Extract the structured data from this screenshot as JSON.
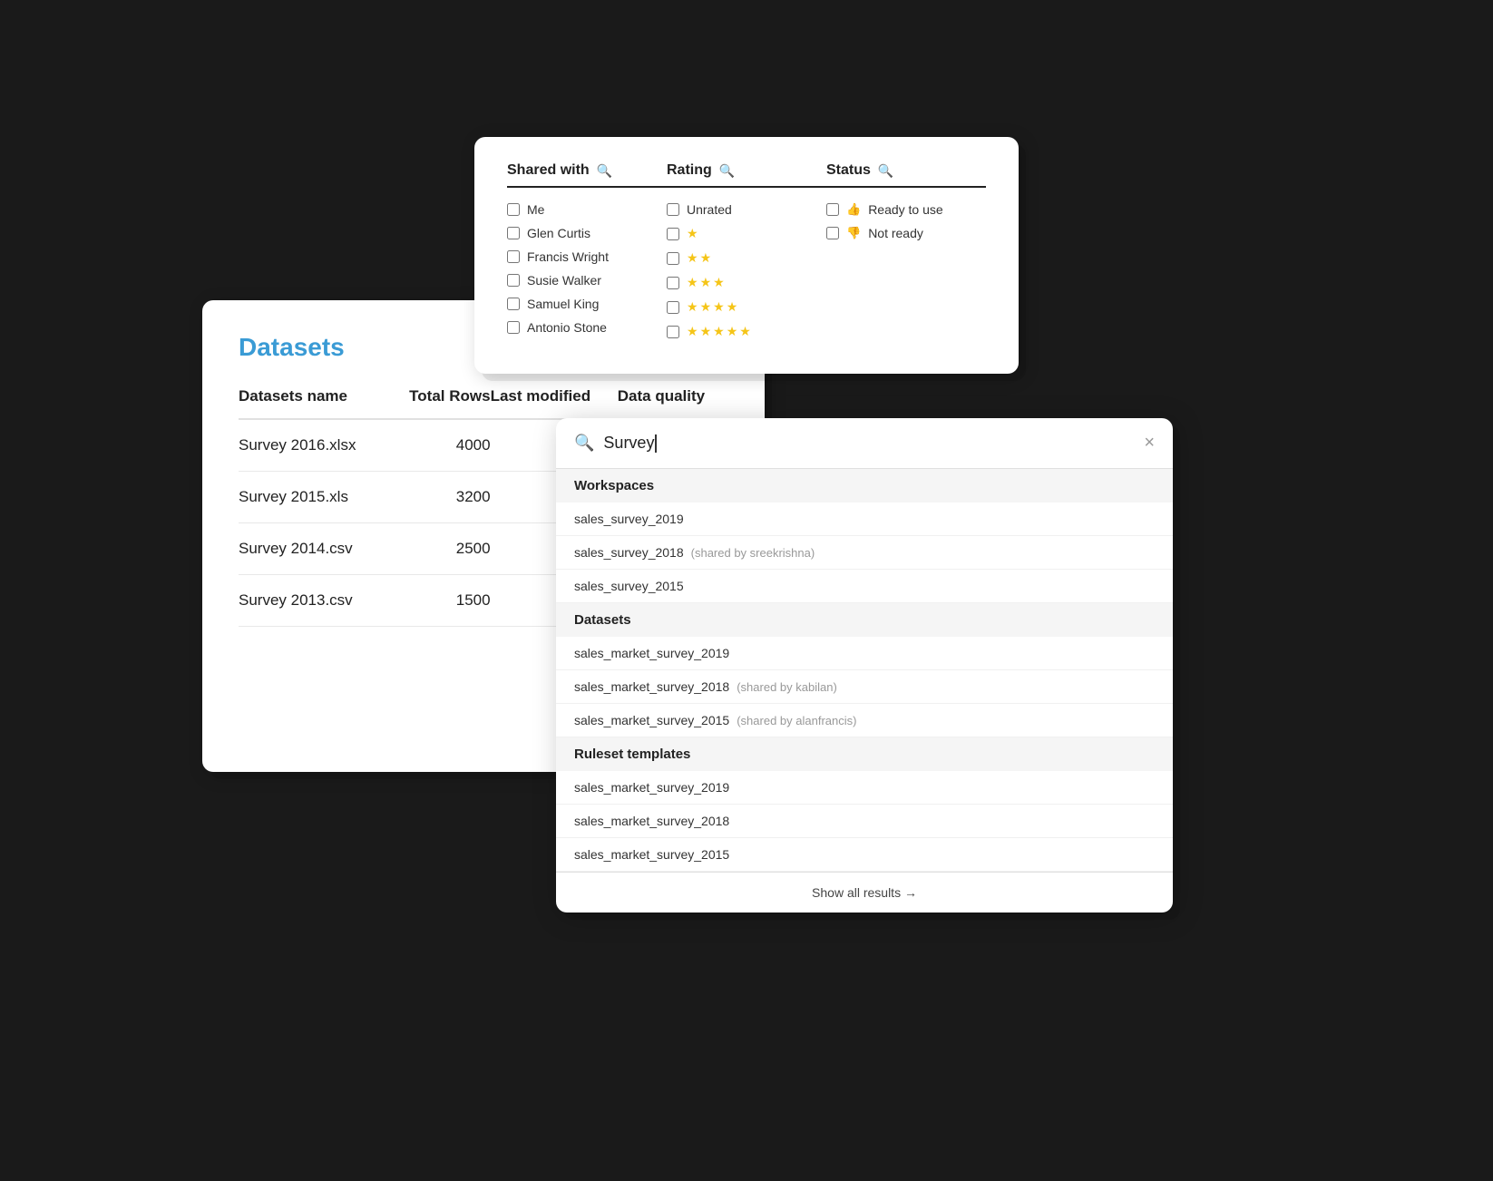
{
  "datasets_card": {
    "title": "Datasets",
    "table": {
      "headers": [
        "Datasets name",
        "Total Rows",
        "Last modified",
        "Data quality"
      ],
      "rows": [
        {
          "name": "Survey 2016.xlsx",
          "rows": "4000",
          "modified": "",
          "quality": ""
        },
        {
          "name": "Survey 2015.xls",
          "rows": "3200",
          "modified": "",
          "quality": ""
        },
        {
          "name": "Survey 2014.csv",
          "rows": "2500",
          "modified": "",
          "quality": ""
        },
        {
          "name": "Survey 2013.csv",
          "rows": "1500",
          "modified": "",
          "quality": ""
        }
      ]
    }
  },
  "filter_card": {
    "shared_with": {
      "label": "Shared with",
      "items": [
        "Me",
        "Glen Curtis",
        "Francis Wright",
        "Susie Walker",
        "Samuel King",
        "Antonio Stone"
      ]
    },
    "rating": {
      "label": "Rating",
      "items": [
        {
          "label": "Unrated",
          "stars": 0
        },
        {
          "label": "",
          "stars": 1
        },
        {
          "label": "",
          "stars": 2
        },
        {
          "label": "",
          "stars": 3
        },
        {
          "label": "",
          "stars": 4
        },
        {
          "label": "",
          "stars": 5
        }
      ]
    },
    "status": {
      "label": "Status",
      "items": [
        {
          "label": "Ready to use",
          "icon": "thumbs-up"
        },
        {
          "label": "Not ready",
          "icon": "thumbs-down"
        }
      ]
    }
  },
  "search_card": {
    "query": "Survey",
    "close_label": "×",
    "sections": [
      {
        "label": "Workspaces",
        "items": [
          {
            "name": "sales_survey_2019",
            "shared": ""
          },
          {
            "name": "sales_survey_2018",
            "shared": "(shared by sreekrishna)"
          },
          {
            "name": "sales_survey_2015",
            "shared": ""
          }
        ]
      },
      {
        "label": "Datasets",
        "items": [
          {
            "name": "sales_market_survey_2019",
            "shared": ""
          },
          {
            "name": "sales_market_survey_2018",
            "shared": "(shared by kabilan)"
          },
          {
            "name": "sales_market_survey_2015",
            "shared": "(shared by alanfrancis)"
          }
        ]
      },
      {
        "label": "Ruleset templates",
        "items": [
          {
            "name": "sales_market_survey_2019",
            "shared": ""
          },
          {
            "name": "sales_market_survey_2018",
            "shared": ""
          },
          {
            "name": "sales_market_survey_2015",
            "shared": ""
          }
        ]
      }
    ],
    "footer": "Show all results →"
  }
}
